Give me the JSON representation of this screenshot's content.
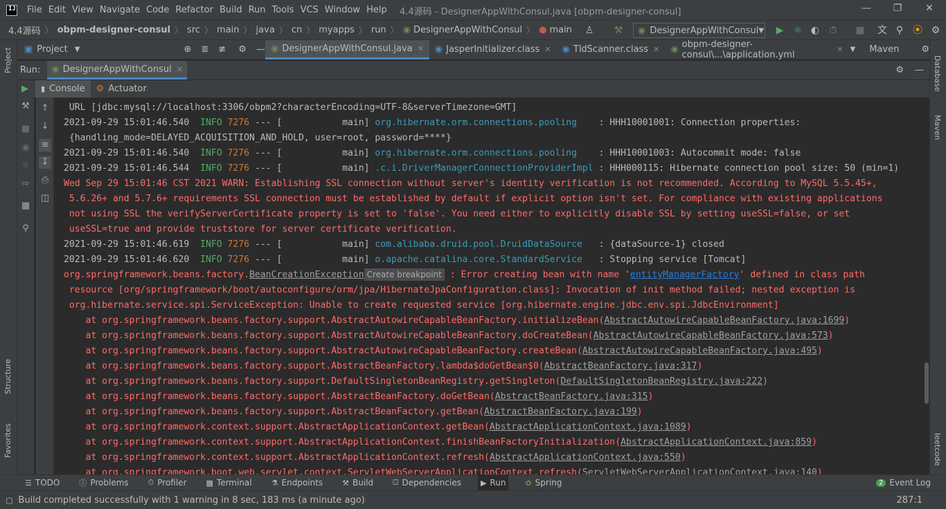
{
  "menubar": {
    "items": [
      "File",
      "Edit",
      "View",
      "Navigate",
      "Code",
      "Refactor",
      "Build",
      "Run",
      "Tools",
      "VCS",
      "Window",
      "Help"
    ],
    "mnemonics": [
      "F",
      "E",
      "V",
      "N",
      "C",
      "R",
      "B",
      "u",
      "T",
      "S",
      "W",
      "H"
    ],
    "window_title": "4.4源码 - DesignerAppWithConsul.java [obpm-designer-consul]",
    "logo_text": "IJ"
  },
  "breadcrumb": [
    "4.4源码",
    "obpm-designer-consul",
    "src",
    "main",
    "java",
    "cn",
    "myapps",
    "run",
    "DesignerAppWithConsul",
    "main"
  ],
  "toolbar": {
    "run_config": "DesignerAppWithConsul"
  },
  "editor_tabs": {
    "project_label": "Project",
    "tabs": [
      {
        "label": "DesignerAppWithConsul.java",
        "active": true
      },
      {
        "label": "JasperInitializer.class",
        "active": false
      },
      {
        "label": "TldScanner.class",
        "active": false
      },
      {
        "label": "obpm-designer-consul\\...\\application.yml",
        "active": false
      }
    ],
    "maven_label": "Maven"
  },
  "side_labels": {
    "left": [
      "Project",
      "Structure",
      "Favorites"
    ],
    "right": [
      "Database",
      "Maven",
      "Ieetcode"
    ]
  },
  "run_panel": {
    "label": "Run:",
    "tab": "DesignerAppWithConsul",
    "console_tab": "Console",
    "actuator_tab": "Actuator"
  },
  "console": {
    "lines": [
      {
        "type": "plain",
        "text": " URL [jdbc:mysql://localhost:3306/obpm2?characterEncoding=UTF-8&serverTimezone=GMT]"
      },
      {
        "type": "log",
        "ts": "2021-09-29 15:01:46.540",
        "level": "INFO",
        "pid": "7276",
        "thread": " --- [           main] ",
        "logger": "org.hibernate.orm.connections.pooling   ",
        "msg": " : HHH10001001: Connection properties:"
      },
      {
        "type": "plain",
        "text": " {handling_mode=DELAYED_ACQUISITION_AND_HOLD, user=root, password=****}"
      },
      {
        "type": "log",
        "ts": "2021-09-29 15:01:46.540",
        "level": "INFO",
        "pid": "7276",
        "thread": " --- [           main] ",
        "logger": "org.hibernate.orm.connections.pooling   ",
        "msg": " : HHH10001003: Autocommit mode: false"
      },
      {
        "type": "log",
        "ts": "2021-09-29 15:01:46.544",
        "level": "INFO",
        "pid": "7276",
        "thread": " --- [           main] ",
        "logger": ".c.i.DriverManagerConnectionProviderImpl",
        "msg": " : HHH000115: Hibernate connection pool size: 50 (min=1)"
      },
      {
        "type": "err",
        "text": "Wed Sep 29 15:01:46 CST 2021 WARN: Establishing SSL connection without server's identity verification is not recommended. According to MySQL 5.5.45+,"
      },
      {
        "type": "err",
        "text": " 5.6.26+ and 5.7.6+ requirements SSL connection must be established by default if explicit option isn't set. For compliance with existing applications"
      },
      {
        "type": "err",
        "text": " not using SSL the verifyServerCertificate property is set to 'false'. You need either to explicitly disable SSL by setting useSSL=false, or set"
      },
      {
        "type": "err",
        "text": " useSSL=true and provide truststore for server certificate verification."
      },
      {
        "type": "log",
        "ts": "2021-09-29 15:01:46.619",
        "level": "INFO",
        "pid": "7276",
        "thread": " --- [           main] ",
        "logger": "com.alibaba.druid.pool.DruidDataSource  ",
        "msg": " : {dataSource-1} closed"
      },
      {
        "type": "log",
        "ts": "2021-09-29 15:01:46.620",
        "level": "INFO",
        "pid": "7276",
        "thread": " --- [           main] ",
        "logger": "o.apache.catalina.core.StandardService  ",
        "msg": " : Stopping service [Tomcat]"
      },
      {
        "type": "exc",
        "pre": "org.springframework.beans.factory.",
        "cls": "BeanCreationException",
        "tip": "Create breakpoint",
        "mid": " : Error creating bean with name '",
        "bean": "entityManagerFactory",
        "post": "' defined in class path"
      },
      {
        "type": "err",
        "text": " resource [org/springframework/boot/autoconfigure/orm/jpa/HibernateJpaConfiguration.class]: Invocation of init method failed; nested exception is"
      },
      {
        "type": "err",
        "text": " org.hibernate.service.spi.ServiceException: Unable to create requested service [org.hibernate.engine.jdbc.env.spi.JdbcEnvironment]"
      },
      {
        "type": "at",
        "text": "\tat org.springframework.beans.factory.support.AbstractAutowireCapableBeanFactory.initializeBean(",
        "link": "AbstractAutowireCapableBeanFactory.java:1699",
        "end": ")"
      },
      {
        "type": "at",
        "text": "\tat org.springframework.beans.factory.support.AbstractAutowireCapableBeanFactory.doCreateBean(",
        "link": "AbstractAutowireCapableBeanFactory.java:573",
        "end": ")"
      },
      {
        "type": "at",
        "text": "\tat org.springframework.beans.factory.support.AbstractAutowireCapableBeanFactory.createBean(",
        "link": "AbstractAutowireCapableBeanFactory.java:495",
        "end": ")"
      },
      {
        "type": "at",
        "text": "\tat org.springframework.beans.factory.support.AbstractBeanFactory.lambda$doGetBean$0(",
        "link": "AbstractBeanFactory.java:317",
        "end": ")"
      },
      {
        "type": "at",
        "text": "\tat org.springframework.beans.factory.support.DefaultSingletonBeanRegistry.getSingleton(",
        "link": "DefaultSingletonBeanRegistry.java:222",
        "end": ")"
      },
      {
        "type": "at",
        "text": "\tat org.springframework.beans.factory.support.AbstractBeanFactory.doGetBean(",
        "link": "AbstractBeanFactory.java:315",
        "end": ")"
      },
      {
        "type": "at",
        "text": "\tat org.springframework.beans.factory.support.AbstractBeanFactory.getBean(",
        "link": "AbstractBeanFactory.java:199",
        "end": ")"
      },
      {
        "type": "at",
        "text": "\tat org.springframework.context.support.AbstractApplicationContext.getBean(",
        "link": "AbstractApplicationContext.java:1089",
        "end": ")"
      },
      {
        "type": "at",
        "text": "\tat org.springframework.context.support.AbstractApplicationContext.finishBeanFactoryInitialization(",
        "link": "AbstractApplicationContext.java:859",
        "end": ")"
      },
      {
        "type": "at",
        "text": "\tat org.springframework.context.support.AbstractApplicationContext.refresh(",
        "link": "AbstractApplicationContext.java:550",
        "end": ")"
      },
      {
        "type": "at",
        "text": "\tat org.springframework.boot.web.servlet.context.ServletWebServerApplicationContext.refresh(",
        "link": "ServletWebServerApplicationContext.java:140",
        "end": ")"
      }
    ]
  },
  "bottom_tools": [
    "TODO",
    "Problems",
    "Profiler",
    "Terminal",
    "Endpoints",
    "Build",
    "Dependencies",
    "Run",
    "Spring"
  ],
  "event_log": {
    "count": "2",
    "label": "Event Log"
  },
  "status": {
    "message": "Build completed successfully with 1 warning in 8 sec, 183 ms (a minute ago)",
    "position": "287:1"
  },
  "colors": {
    "bg": "#2b2b2b",
    "panel": "#3c3f41",
    "error_text": "#ff6b68",
    "info_level": "#6a8759",
    "logger": "#3d9ab7",
    "pid": "#cc7832",
    "accent": "#4a88c7"
  }
}
